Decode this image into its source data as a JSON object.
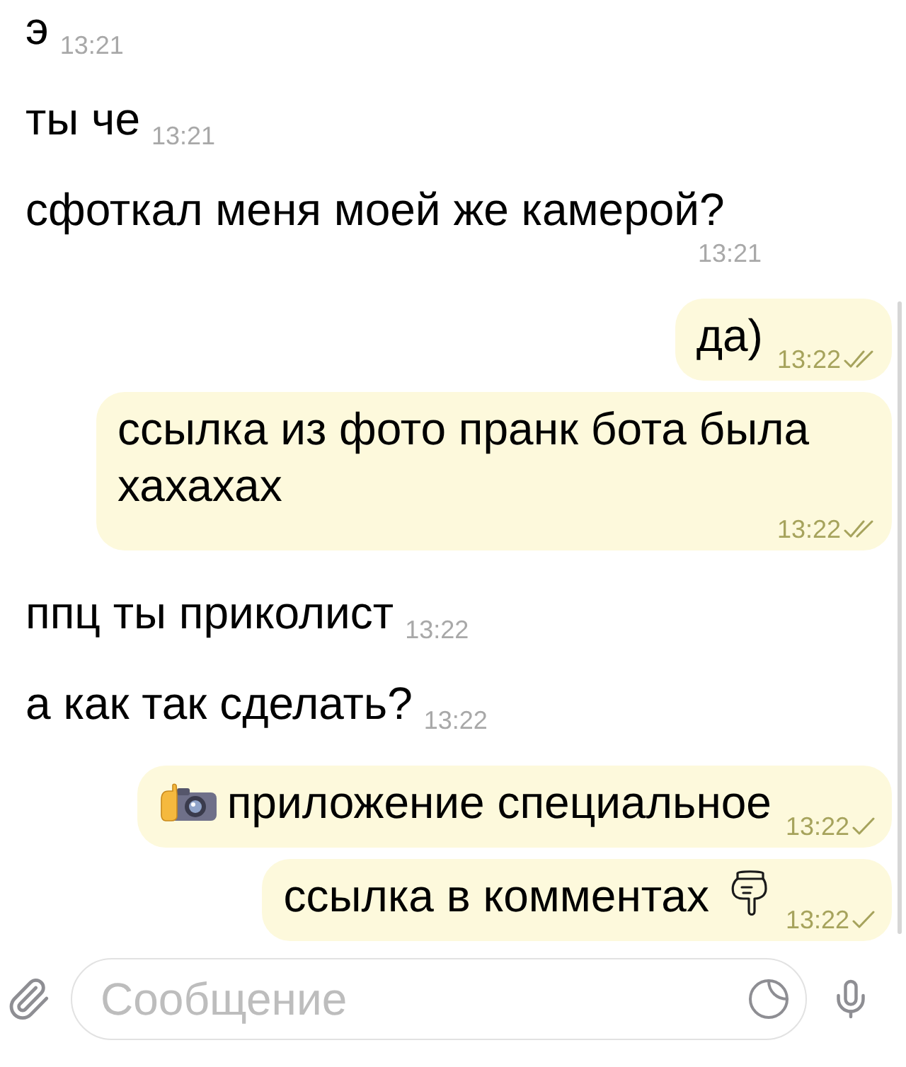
{
  "messages": [
    {
      "kind": "incoming",
      "text": "э",
      "time": "13:21"
    },
    {
      "kind": "incoming",
      "text": "ты че",
      "time": "13:21"
    },
    {
      "kind": "incoming",
      "text": "сфоткал меня моей же камерой?",
      "time": "13:21"
    },
    {
      "kind": "outgoing",
      "text": "да)",
      "time": "13:22",
      "read": true
    },
    {
      "kind": "outgoing",
      "text": "ссылка из фото пранк бота была хахахах",
      "time": "13:22",
      "read": true
    },
    {
      "kind": "incoming",
      "text": "ппц ты приколист",
      "time": "13:22"
    },
    {
      "kind": "incoming",
      "text": "а как так сделать?",
      "time": "13:22"
    },
    {
      "kind": "outgoing",
      "text": "приложение специальное",
      "time": "13:22",
      "read": false,
      "lead_icon": {
        "kind": "camera"
      }
    },
    {
      "kind": "outgoing",
      "text": "ссылка в комментах",
      "time": "13:22",
      "read": false,
      "tail_icon": {
        "kind": "hand"
      }
    }
  ],
  "composer": {
    "placeholder": "Сообщение"
  }
}
